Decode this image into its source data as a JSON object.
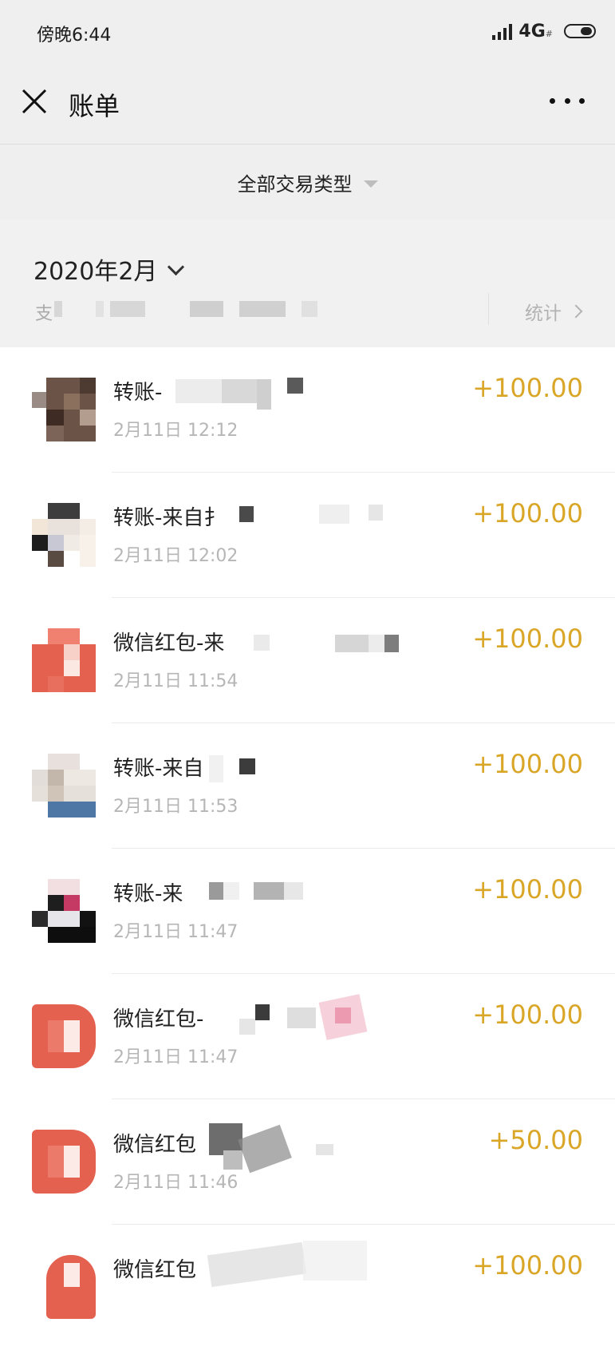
{
  "status": {
    "time": "傍晚6:44",
    "network": "4G",
    "network_sub": "#"
  },
  "nav": {
    "title": "账单"
  },
  "filter": {
    "label": "全部交易类型"
  },
  "month": {
    "label": "2020年2月",
    "summary_prefix": "支",
    "stats_label": "统计"
  },
  "transactions": [
    {
      "title": "转账-",
      "time": "2月11日 12:12",
      "amount": "+100.00",
      "avatar": "photo-avatar"
    },
    {
      "title": "转账-来自扌",
      "time": "2月11日 12:02",
      "amount": "+100.00",
      "avatar": "photo-avatar"
    },
    {
      "title": "微信红包-来",
      "time": "2月11日 11:54",
      "amount": "+100.00",
      "avatar": "red-packet-icon"
    },
    {
      "title": "转账-来自",
      "time": "2月11日 11:53",
      "amount": "+100.00",
      "avatar": "photo-avatar"
    },
    {
      "title": "转账-来",
      "time": "2月11日 11:47",
      "amount": "+100.00",
      "avatar": "photo-avatar"
    },
    {
      "title": "微信红包-",
      "time": "2月11日 11:47",
      "amount": "+100.00",
      "avatar": "red-packet-icon"
    },
    {
      "title": "微信红包",
      "time": "2月11日 11:46",
      "amount": "+50.00",
      "avatar": "red-packet-icon"
    },
    {
      "title": "微信红包",
      "time": "",
      "amount": "+100.00",
      "avatar": "red-packet-icon"
    }
  ],
  "colors": {
    "amount": "#d9a627",
    "red_packet": "#e4604f"
  }
}
